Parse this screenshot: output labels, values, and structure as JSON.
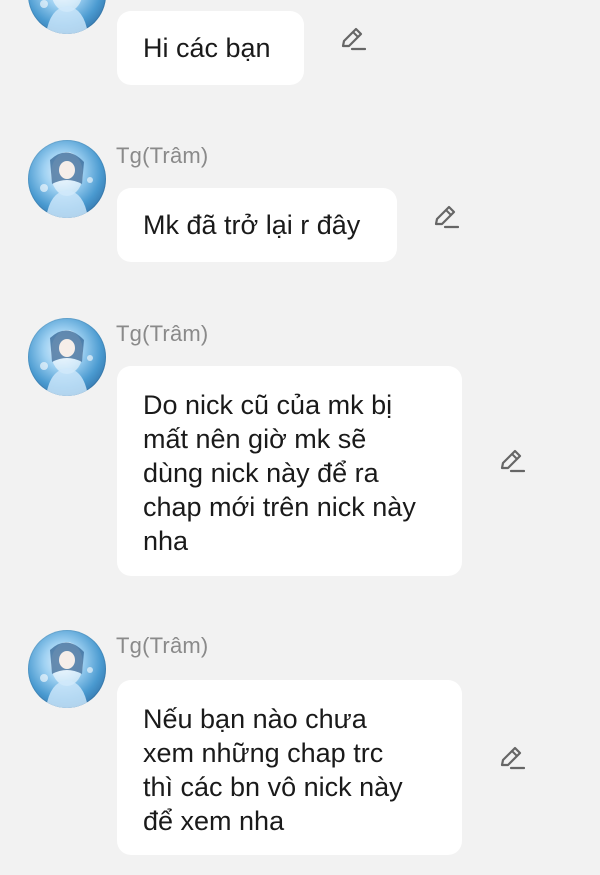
{
  "messages": [
    {
      "sender": "",
      "text": "Hi các bạn",
      "icon": "pencil-edit-icon"
    },
    {
      "sender": "Tg(Trâm)",
      "text": "Mk đã trở lại r đây",
      "icon": "pencil-edit-icon"
    },
    {
      "sender": "Tg(Trâm)",
      "lines": [
        "Do nick cũ của mk bị",
        "mất nên giờ mk sẽ",
        "dùng nick này để ra",
        "chap mới trên nick này",
        "nha"
      ],
      "icon": "pencil-edit-icon"
    },
    {
      "sender": "Tg(Trâm)",
      "lines": [
        "Nếu bạn nào chưa",
        "xem những chap trc",
        "thì các bn vô nick này",
        "để xem nha"
      ],
      "icon": "pencil-edit-icon"
    }
  ],
  "colors": {
    "background": "#f2f2f2",
    "bubble": "#ffffff",
    "sender": "#8a8a8a",
    "text": "#1a1a1a",
    "icon": "#666666"
  }
}
